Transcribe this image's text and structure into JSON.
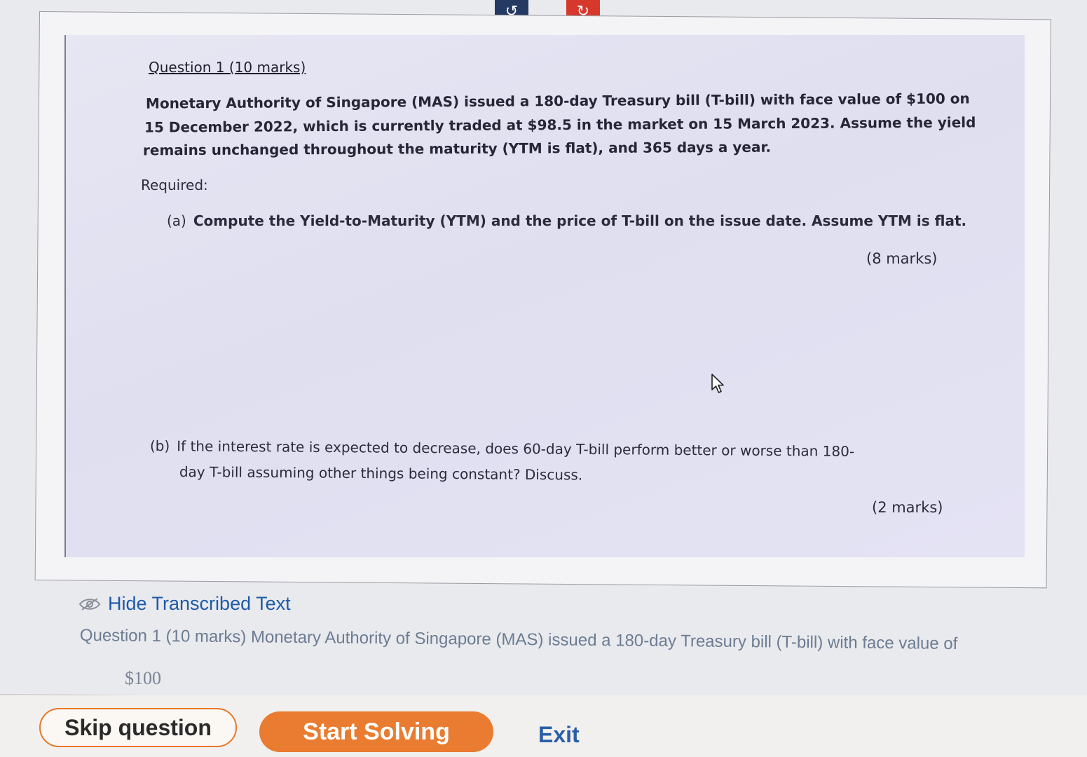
{
  "toolbar": {
    "undo_icon": "undo-icon",
    "redo_icon": "redo-icon",
    "undo_color": "#243a63",
    "redo_color": "#d6382c"
  },
  "question": {
    "title": "Question 1 (10 marks)",
    "paragraph_lines": [
      "Monetary Authority of Singapore (MAS) issued a 180-day Treasury bill (T-bill) with face value of $100 on",
      "15 December 2022, which is currently traded at $98.5 in the market on 15 March 2023. Assume the yield",
      "remains unchanged throughout the maturity (YTM is flat), and 365 days a year."
    ],
    "required_label": "Required:",
    "part_a": {
      "tag": "(a)",
      "text": "Compute the Yield-to-Maturity (YTM) and the price of T-bill on the issue date. Assume YTM is flat.",
      "marks": "(8 marks)"
    },
    "part_b": {
      "tag": "(b)",
      "line1": "If the interest rate is expected to decrease, does 60-day T-bill perform better or worse than 180-",
      "line2": "day T-bill assuming other things being constant? Discuss.",
      "marks": "(2 marks)"
    }
  },
  "transcription": {
    "toggle_label": "Hide Transcribed Text",
    "toggle_icon": "eye-slash-icon",
    "text": "Question 1 (10 marks) Monetary Authority of Singapore (MAS) issued a 180-day Treasury bill (T-bill) with face value of",
    "amount": "$100"
  },
  "footer": {
    "skip_label": "Skip question",
    "start_label": "Start Solving",
    "exit_label": "Exit",
    "accent": "#e97c30",
    "link_color": "#2a5fa6"
  }
}
